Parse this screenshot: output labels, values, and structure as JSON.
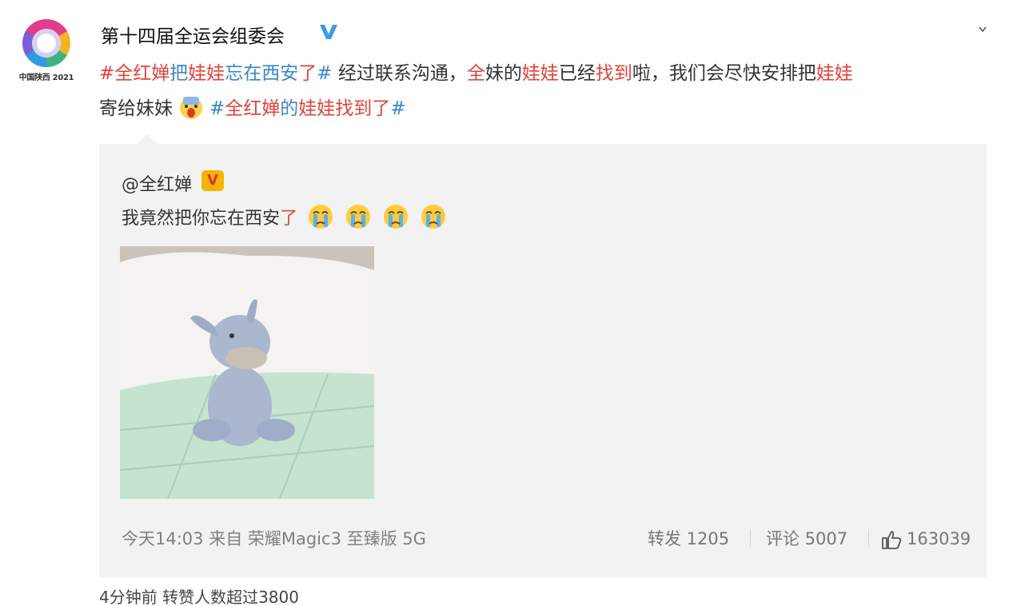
{
  "account": {
    "name": "第十四届全运会组委会",
    "avatar_caption": "中国陕西 2021",
    "verified_icon": "blue-v-verified-icon"
  },
  "post": {
    "segments": [
      {
        "text": "#全红婵",
        "style": "ht-red"
      },
      {
        "text": "把",
        "style": "ht-blue"
      },
      {
        "text": "娃娃",
        "style": "ht-red"
      },
      {
        "text": "忘在西安",
        "style": "ht-blue"
      },
      {
        "text": "了",
        "style": "ht-red"
      },
      {
        "text": "# ",
        "style": "ht-blue"
      },
      {
        "text": "经过联系沟通，",
        "style": "plain"
      },
      {
        "text": "全",
        "style": "ht-red"
      },
      {
        "text": "妹的",
        "style": "plain"
      },
      {
        "text": "娃娃",
        "style": "ht-red"
      },
      {
        "text": "已经",
        "style": "plain"
      },
      {
        "text": "找到",
        "style": "ht-red"
      },
      {
        "text": "啦，我们会尽快安排把",
        "style": "plain"
      },
      {
        "text": "娃娃",
        "style": "ht-red"
      }
    ],
    "line2_plain": "寄给妹妹",
    "line2_hashtag": [
      {
        "text": "#",
        "style": "ht-blue"
      },
      {
        "text": "全红婵",
        "style": "ht-red"
      },
      {
        "text": "的",
        "style": "ht-blue"
      },
      {
        "text": "娃娃找到了",
        "style": "ht-red"
      },
      {
        "text": "#",
        "style": "ht-blue"
      }
    ]
  },
  "repost": {
    "author": "@全红婵",
    "author_badge": "V",
    "text_main": "我竟然把你忘在西安",
    "text_red": "了",
    "emoji_count_icon": "crying-face-icon",
    "time_source": "今天14:03 来自 荣耀Magic3 至臻版 5G",
    "repost_label": "转发 1205",
    "comment_label": "评论 5007",
    "like_count": "163039"
  },
  "footer": {
    "text": "4分钟前  转赞人数超过3800"
  },
  "colors": {
    "hashtag_blue": "#3a86c8",
    "hashtag_red": "#e0433a",
    "repost_bg": "#f2f2f2"
  }
}
